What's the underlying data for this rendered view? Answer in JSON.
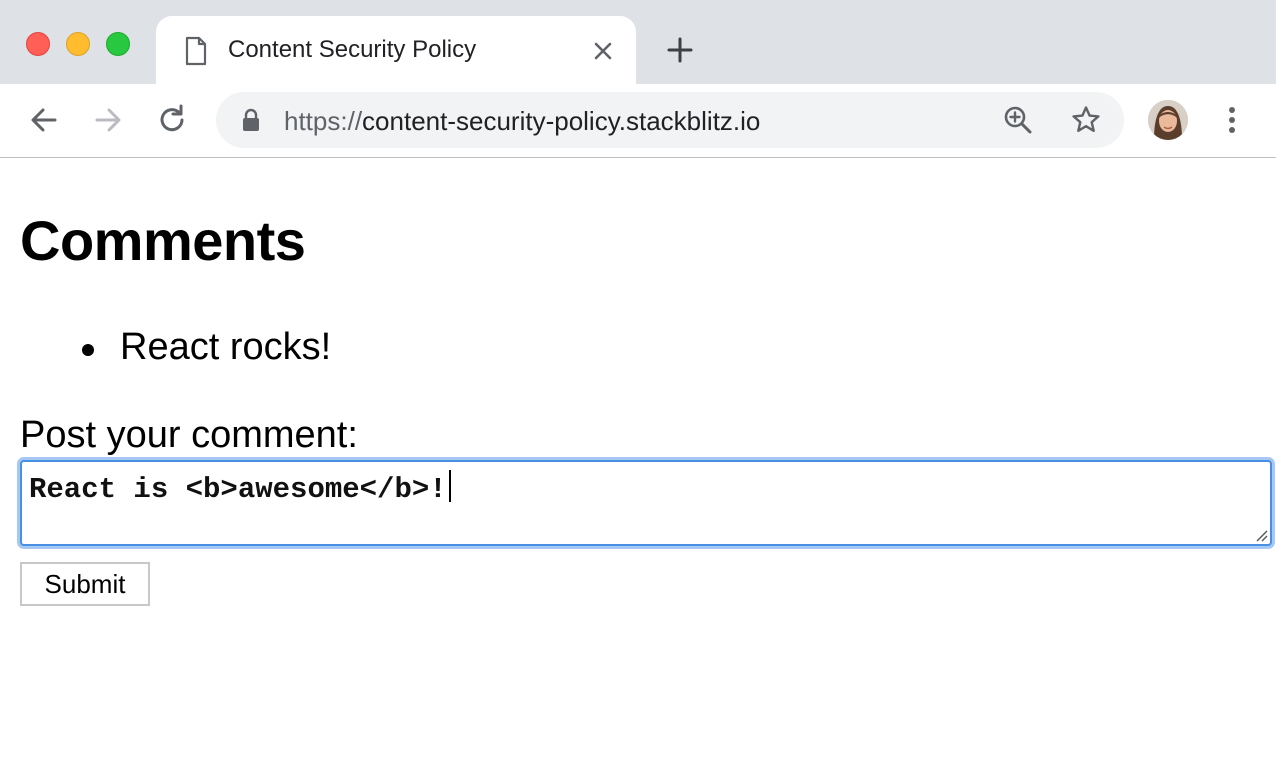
{
  "browser": {
    "tab": {
      "title": "Content Security Policy",
      "icon": "document-icon"
    },
    "address_bar": {
      "scheme": "https://",
      "host": "content-security-policy.stackblitz.io"
    },
    "icons": [
      "back-arrow-icon",
      "forward-arrow-icon",
      "reload-icon",
      "lock-icon",
      "zoom-in-icon",
      "star-icon",
      "avatar",
      "more-menu-icon",
      "close-icon",
      "plus-icon"
    ],
    "colors": {
      "tabstrip": "#dee1e6",
      "omnibox": "#f1f3f4",
      "focus_ring": "#4a90e2"
    }
  },
  "page": {
    "heading": "Comments",
    "comments": [
      {
        "text": "React rocks!"
      }
    ],
    "form": {
      "label": "Post your comment:",
      "textarea_value": "React is <b>awesome</b>!",
      "submit_label": "Submit"
    }
  }
}
